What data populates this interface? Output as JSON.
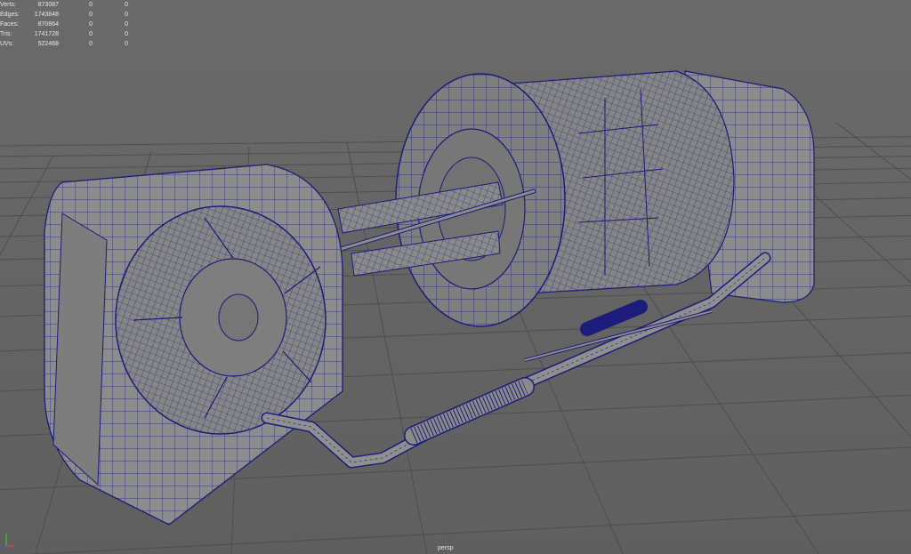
{
  "hud": {
    "rows": [
      {
        "label": "Verts:",
        "total": "873087",
        "selected": "0",
        "component": "0"
      },
      {
        "label": "Edges:",
        "total": "1743848",
        "selected": "0",
        "component": "0"
      },
      {
        "label": "Faces:",
        "total": "870864",
        "selected": "0",
        "component": "0"
      },
      {
        "label": "Tris:",
        "total": "1741728",
        "selected": "0",
        "component": "0"
      },
      {
        "label": "UVs:",
        "total": "522468",
        "selected": "0",
        "component": "0"
      }
    ]
  },
  "viewport": {
    "camera": "persp",
    "colors": {
      "background": "#666666",
      "grid": "#4e4e4e",
      "mesh": "#8c8c8c",
      "wire": "#1c1c7a"
    }
  },
  "icons": {
    "axis": "axis-gizmo-icon"
  }
}
